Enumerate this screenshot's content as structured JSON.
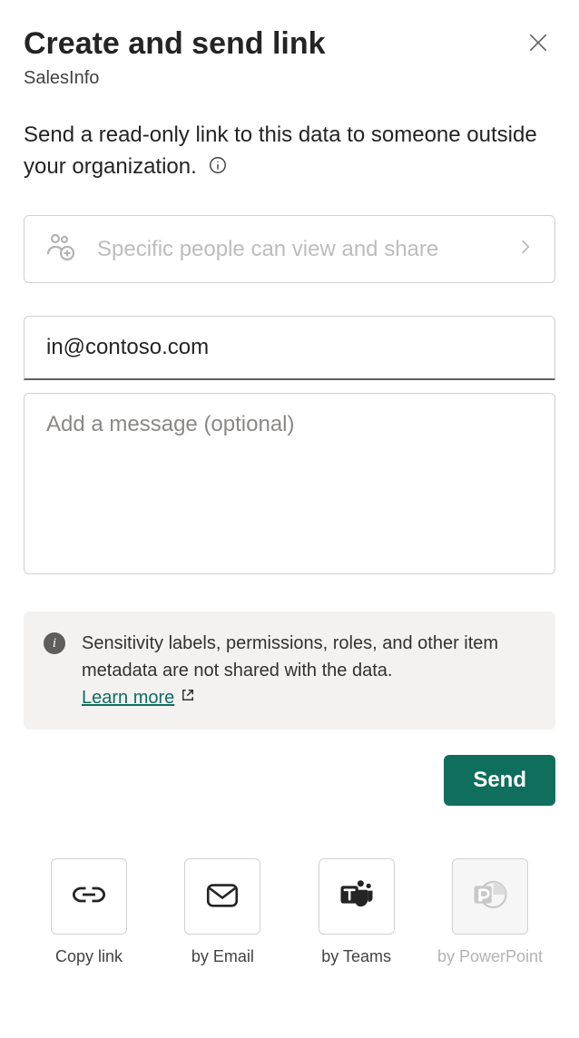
{
  "header": {
    "title": "Create and send link",
    "subtitle": "SalesInfo"
  },
  "description": "Send a read-only link to this data to someone outside your organization.",
  "permission_card": {
    "text": "Specific people can view and share"
  },
  "form": {
    "email_value": "in@contoso.com",
    "message_placeholder": "Add a message (optional)"
  },
  "notice": {
    "text": "Sensitivity labels, permissions, roles, and other item metadata are not shared with the data.",
    "learn_more": "Learn more"
  },
  "actions": {
    "send": "Send"
  },
  "share_options": {
    "copy_link": "Copy link",
    "by_email": "by Email",
    "by_teams": "by Teams",
    "by_powerpoint": "by PowerPoint"
  }
}
